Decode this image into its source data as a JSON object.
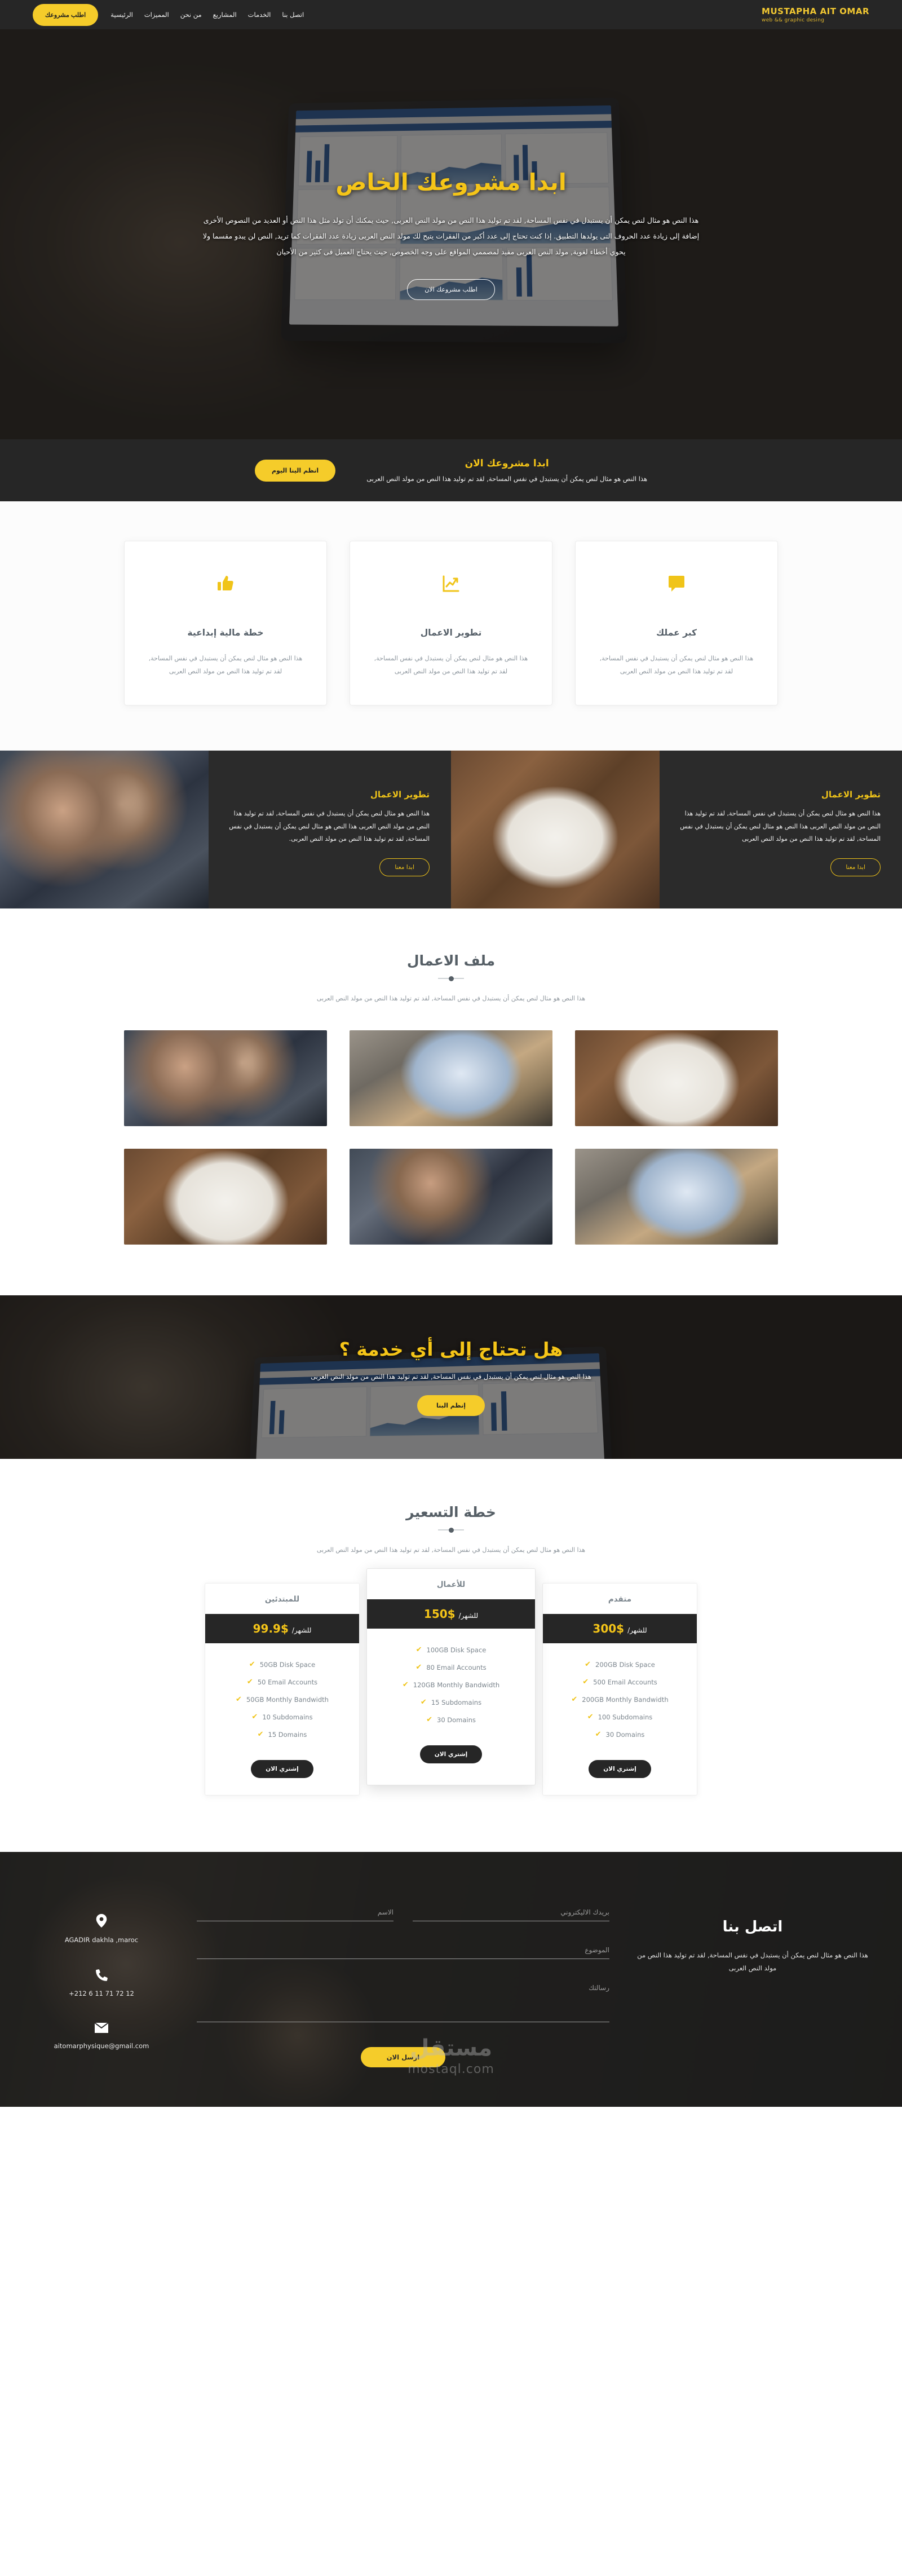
{
  "brand": {
    "name": "MUSTAPHA AIT OMAR",
    "tagline": "web && graphic desing"
  },
  "nav": {
    "items": [
      {
        "label": "الرئيسية"
      },
      {
        "label": "المميزات"
      },
      {
        "label": "من نحن"
      },
      {
        "label": "المشاريع"
      },
      {
        "label": "الخدمات"
      },
      {
        "label": "اتصل بنا"
      }
    ],
    "cta_label": "اطلب مشروعك"
  },
  "hero": {
    "title": "ابدا مشروعك الخاص",
    "text": "هذا النص هو مثال لنص يمكن أن يستبدل في نفس المساحة, لقد تم توليد هذا النص من مولد النص العربى, حيث يمكنك أن تولد مثل هذا النص أو العديد من النصوص الأخرى إضافة إلى زيادة عدد الحروف التى يولدها التطبيق. إذا كنت تحتاج إلى عدد أكبر من الفقرات يتيح لك مولد النص العربى زيادة عدد الفقرات كما تريد, النص لن يبدو مقسما ولا يحوي أخطاء لغوية, مولد النص العربى مفيد لمصممي المواقع على وجه الخصوص, حيث يحتاج العميل فى كثير من الأحيان",
    "button_label": "اطلب مشروعك الان"
  },
  "cta_band": {
    "title": "ابدا مشروعك الان",
    "subtitle": "هذا النص هو مثال لنص يمكن أن يستبدل في نفس المساحة, لقد تم توليد هذا النص من مولد النص العربى",
    "button_label": "انظم الينا اليوم"
  },
  "features": {
    "cards": [
      {
        "icon": "speech-bubble-icon",
        "glyph": "🗨",
        "title": "كبر عملك",
        "text": "هذا النص هو مثال لنص يمكن أن يستبدل في نفس المساحة, لقد تم توليد هذا النص من مولد النص العربى"
      },
      {
        "icon": "chart-growth-icon",
        "glyph": "📈",
        "title": "تطوير الاعمال",
        "text": "هذا النص هو مثال لنص يمكن أن يستبدل في نفس المساحة, لقد تم توليد هذا النص من مولد النص العربى"
      },
      {
        "icon": "thumbs-up-icon",
        "glyph": "👍",
        "title": "خطة مالية إبداعية",
        "text": "هذا النص هو مثال لنص يمكن أن يستبدل في نفس المساحة, لقد تم توليد هذا النص من مولد النص العربى"
      }
    ]
  },
  "split": {
    "blocks": [
      {
        "image": "desk-planning-photo",
        "title": "تطوير الاعمال",
        "text": "هذا النص هو مثال لنص يمكن أن يستبدل في نفس المساحة, لقد تم توليد هذا النص من مولد النص العربى هذا النص هو مثال لنص يمكن أن يستبدل في نفس المساحة, لقد تم توليد هذا النص من مولد النص العربى",
        "button_label": "ابدا معنا"
      },
      {
        "image": "handshake-photo",
        "title": "تطوير الاعمال",
        "text": "هذا النص هو مثال لنص يمكن أن يستبدل في نفس المساحة, لقد تم توليد هذا النص من مولد النص العربى هذا النص هو مثال لنص يمكن أن يستبدل في نفس المساحة, لقد تم توليد هذا النص من مولد النص العربى.",
        "button_label": "ابدا معنا"
      }
    ]
  },
  "portfolio": {
    "title": "ملف الاعمال",
    "subtitle": "هذا النص هو مثال لنص يمكن أن يستبدل في نفس المساحة, لقد تم توليد هذا النص من مولد النص العربى",
    "items": [
      {
        "name": "desk-planning-photo"
      },
      {
        "name": "laptop-dashboard-photo"
      },
      {
        "name": "handshake-photo"
      },
      {
        "name": "laptop-dashboard-photo"
      },
      {
        "name": "handshake-photo"
      },
      {
        "name": "desk-planning-photo"
      }
    ]
  },
  "service_cta": {
    "title": "هل تحتاج إلى أي خدمة ؟",
    "text": "هذا النص هو مثال لنص يمكن أن يستبدل في نفس المساحة, لقد تم توليد هذا النص من مولد النص العربى",
    "button_label": "إنظم البنا"
  },
  "pricing": {
    "title": "خطة التسعير",
    "subtitle": "هذا النص هو مثال لنص يمكن أن يستبدل في نفس المساحة, لقد تم توليد هذا النص من مولد النص العربى",
    "period_label": "للشهر/",
    "buy_label": "إشتري الان",
    "plans": [
      {
        "name": "متقدم",
        "amount": "300$",
        "features": [
          "200GB Disk Space",
          "500 Email Accounts",
          "200GB Monthly Bandwidth",
          "100 Subdomains",
          "30 Domains"
        ]
      },
      {
        "name": "للأعمال",
        "amount": "150$",
        "features": [
          "100GB Disk Space",
          "80 Email Accounts",
          "120GB Monthly Bandwidth",
          "15 Subdomains",
          "30 Domains"
        ]
      },
      {
        "name": "للمبتدئين",
        "amount": "99.9$",
        "features": [
          "50GB Disk Space",
          "50 Email Accounts",
          "50GB Monthly Bandwidth",
          "10 Subdomains",
          "15 Domains"
        ]
      }
    ]
  },
  "contact": {
    "title": "اتصل بنا",
    "desc": "هذا النص هو مثال لنص يمكن أن يستبدل في نفس المساحة, لقد تم توليد هذا النص من مولد النص العربى",
    "fields": {
      "name_placeholder": "الاسم",
      "email_placeholder": "بريدك الاليكتروني",
      "subject_placeholder": "الموضوع",
      "message_placeholder": "رسالتك"
    },
    "send_label": "ارسل الان",
    "info": [
      {
        "icon": "location-pin-icon",
        "glyph": "📍",
        "text": "AGADIR dakhla ,maroc"
      },
      {
        "icon": "phone-icon",
        "glyph": "📞",
        "text": "+212 6 11 71 72 12"
      },
      {
        "icon": "envelope-icon",
        "glyph": "✉",
        "text": "aitomarphysique@gmail.com"
      }
    ]
  },
  "watermark": {
    "arabic": "مستقل",
    "latin": "mostaql.com"
  },
  "colors": {
    "accent": "#f5c518",
    "dark": "#262626",
    "muted": "#8b949c"
  }
}
